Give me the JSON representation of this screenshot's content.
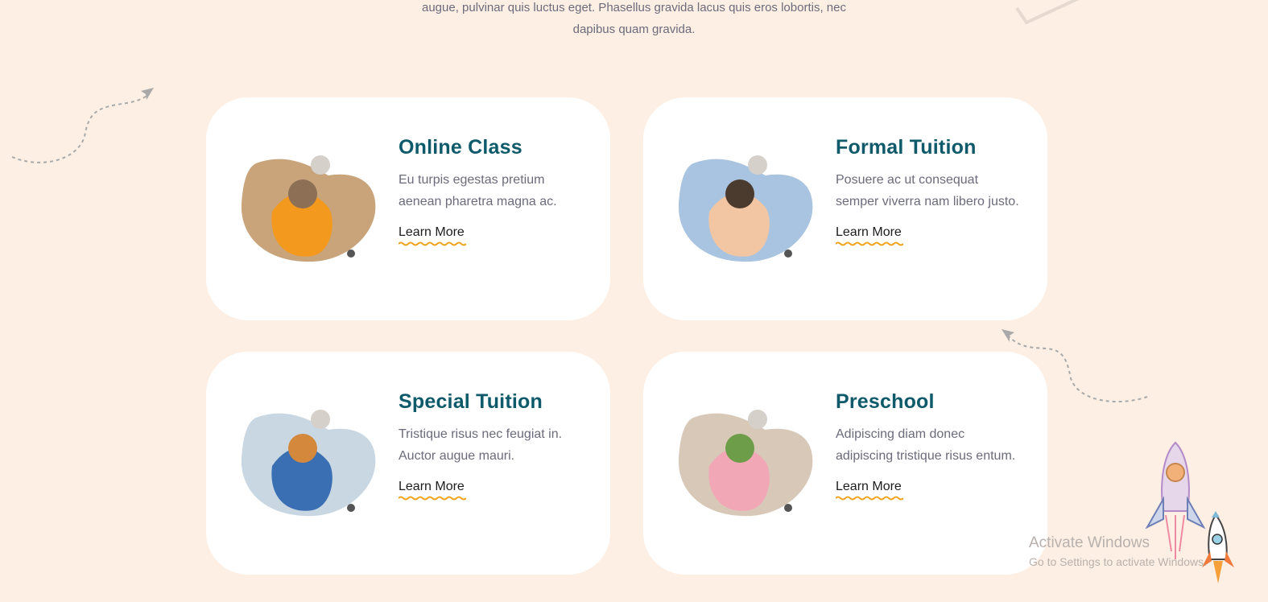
{
  "intro": {
    "line1": "augue, pulvinar quis luctus eget. Phasellus gravida lacus quis eros lobortis, nec",
    "line2": "dapibus quam gravida."
  },
  "cards": [
    {
      "title": "Online Class",
      "desc_line1": "Eu turpis egestas pretium",
      "desc_line2": "aenean pharetra magna ac.",
      "link": "Learn More",
      "image_icon": "child-laptop-photo"
    },
    {
      "title": "Formal Tuition",
      "desc_line1": "Posuere ac ut consequat",
      "desc_line2": "semper viverra nam libero justo.",
      "link": "Learn More",
      "image_icon": "tutor-blocks-photo"
    },
    {
      "title": "Special Tuition",
      "desc_line1": "Tristique risus nec feugiat in.",
      "desc_line2": "Auctor augue mauri.",
      "link": "Learn More",
      "image_icon": "kids-masks-photo"
    },
    {
      "title": "Preschool",
      "desc_line1": "Adipiscing diam donec",
      "desc_line2": "adipiscing tristique risus entum.",
      "link": "Learn More",
      "image_icon": "child-toys-photo"
    }
  ],
  "watermark": {
    "title": "Activate Windows",
    "subtitle": "Go to Settings to activate Windows."
  },
  "colors": {
    "background": "#fdefe4",
    "card": "#ffffff",
    "title": "#0e5a6a",
    "text": "#6b6b7b",
    "accent_underline": "#f0a31c"
  }
}
